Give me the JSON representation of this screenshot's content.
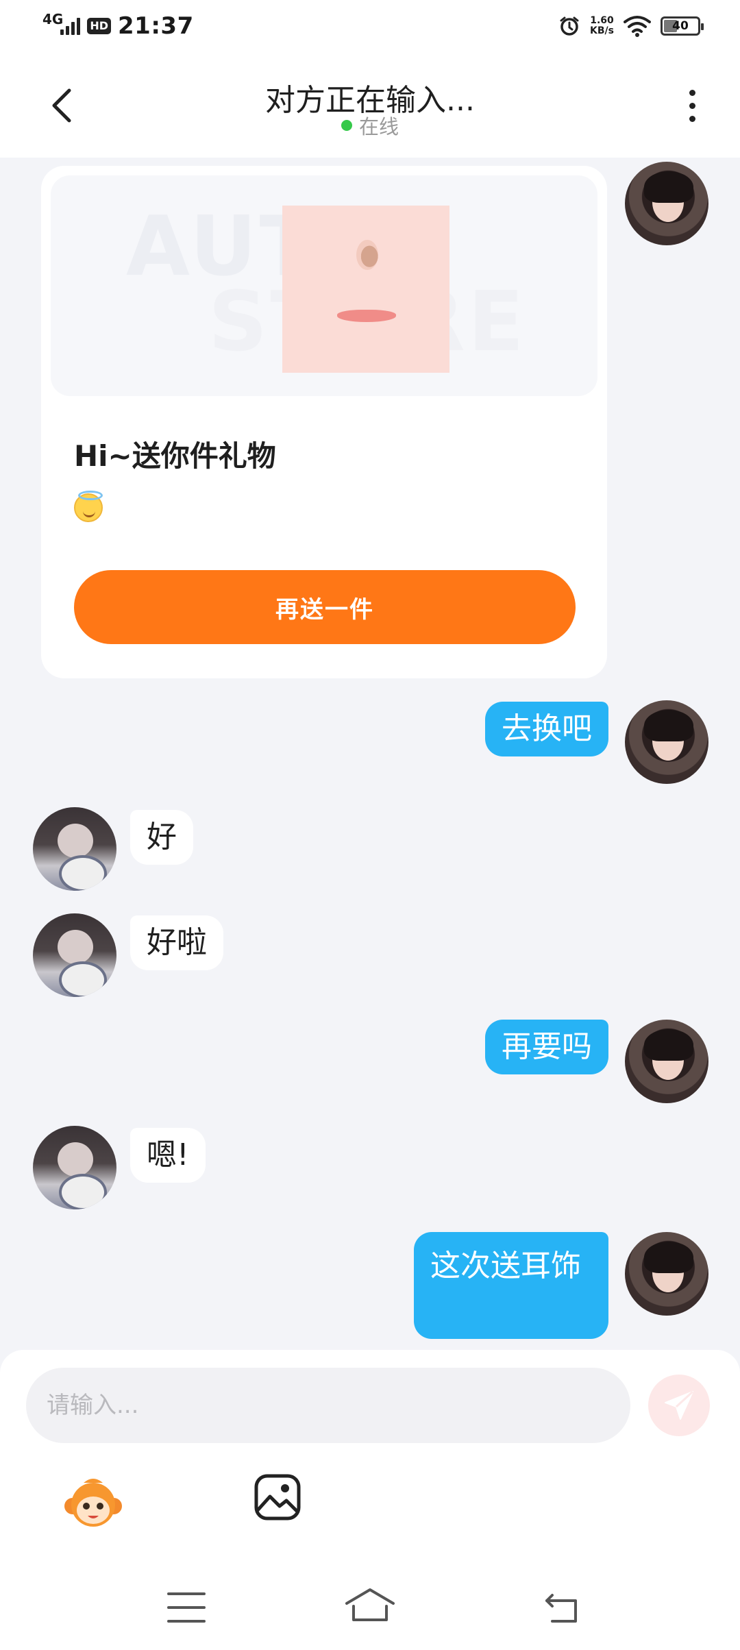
{
  "status_bar": {
    "network": "4G",
    "hd_badge": "HD",
    "time": "21:37",
    "speed_value": "1.60",
    "speed_unit": "KB/s",
    "battery_level": "40",
    "battery_fraction": 0.4
  },
  "header": {
    "title": "对方正在输入...",
    "status_text": "在线",
    "status_color": "#35c94a"
  },
  "gift_card": {
    "watermark_line1": "AUTAR",
    "watermark_line2": "STORE",
    "title": "Hi~送你件礼物",
    "emoji": "smiling-face-with-halo",
    "button_label": "再送一件",
    "button_color": "#ff7716"
  },
  "messages": [
    {
      "sender": "self",
      "text": "去换吧"
    },
    {
      "sender": "other",
      "text": "好"
    },
    {
      "sender": "other",
      "text": "好啦"
    },
    {
      "sender": "self",
      "text": "再要吗"
    },
    {
      "sender": "other",
      "text": "嗯!"
    },
    {
      "sender": "self",
      "text": "这次送耳饰"
    }
  ],
  "composer": {
    "placeholder": "请输入...",
    "value": ""
  },
  "colors": {
    "self_bubble": "#27b3f5",
    "other_bubble": "#ffffff",
    "background": "#f3f4f8"
  }
}
